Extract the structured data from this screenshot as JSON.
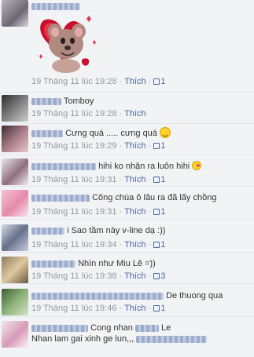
{
  "comments": [
    {
      "meta": {
        "time": "19 Tháng 11 lúc 19:28",
        "like": "Thích",
        "likes": "1"
      }
    },
    {
      "text": "Tomboy",
      "meta": {
        "time": "19 Tháng 11 lúc 19:28",
        "like": "Thích"
      }
    },
    {
      "text": "Cưng quá ..... cưng quá",
      "meta": {
        "time": "19 Tháng 11 lúc 19:29",
        "like": "Thích",
        "likes": "1"
      }
    },
    {
      "text": "hihi ko nhận ra luôn hihi",
      "meta": {
        "time": "19 Tháng 11 lúc 19:31",
        "like": "Thích",
        "likes": "1"
      }
    },
    {
      "text": "Công chúa ô lâu ra đã lấy chồng",
      "meta": {
        "time": "19 Tháng 11 lúc 19:31",
        "like": "Thích",
        "likes": "1"
      }
    },
    {
      "text": "i Sao tầm này v-line dạ :))",
      "meta": {
        "time": "19 Tháng 11 lúc 19:34",
        "like": "Thích",
        "likes": "1"
      }
    },
    {
      "text": "Nhìn như Miu Lê =))",
      "meta": {
        "time": "19 Tháng 11 lúc 19:38",
        "like": "Thích",
        "likes": "3"
      }
    },
    {
      "text": "De thuong qua",
      "meta": {
        "time": "19 Tháng 11 lúc 19:46",
        "like": "Thích",
        "likes": "1"
      }
    },
    {
      "text_a": "Cong nhan",
      "text_b": "Le",
      "text_c": "Nhan lam gai xinh ge lun,,,"
    }
  ]
}
